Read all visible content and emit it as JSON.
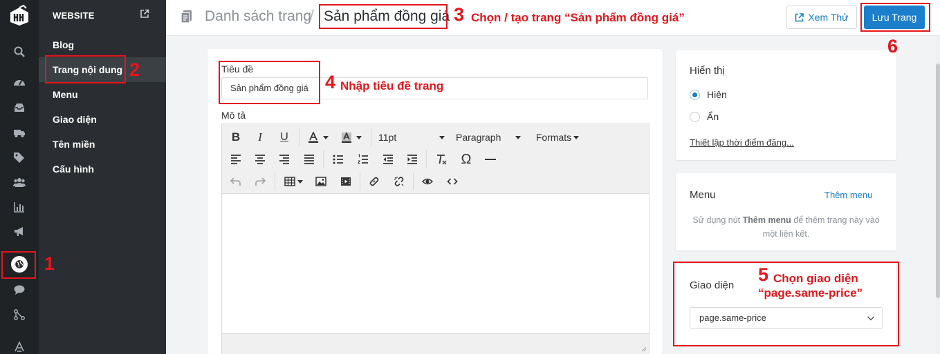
{
  "sidebar": {
    "section_title": "WEBSITE",
    "items": [
      {
        "label": "Blog"
      },
      {
        "label": "Trang nội dung"
      },
      {
        "label": "Menu"
      },
      {
        "label": "Giao diện"
      },
      {
        "label": "Tên miền"
      },
      {
        "label": "Cấu hình"
      }
    ]
  },
  "rail_icons": [
    "logo-icon",
    "search-icon",
    "dashboard-icon",
    "inbox-icon",
    "truck-icon",
    "tags-icon",
    "users-icon",
    "chart-icon",
    "megaphone-icon",
    "globe-icon",
    "chat-icon",
    "share-icon",
    "app-icon"
  ],
  "header": {
    "breadcrumb": "Danh sách trang",
    "separator": "/",
    "current": "Sản phẩm đồng giá",
    "view_button": "Xem Thử",
    "save_button": "Lưu Trang"
  },
  "form": {
    "title_label": "Tiêu đề",
    "title_value": "Sản phẩm đồng giá",
    "desc_label": "Mô tả"
  },
  "editor": {
    "font_size": "11pt",
    "block_format": "Paragraph",
    "formats": "Formats"
  },
  "visibility": {
    "title": "Hiển thị",
    "option_show": "Hiện",
    "option_hide": "Ẩn",
    "selected": "Hiện",
    "schedule_link": "Thiết lập thời điểm đăng..."
  },
  "menu_panel": {
    "title": "Menu",
    "add_link": "Thêm menu",
    "hint_prefix": "Sử dụng nút",
    "hint_bold": "Thêm menu",
    "hint_suffix": "để thêm trang này vào một liên kết."
  },
  "template_panel": {
    "title": "Giao diện",
    "selected": "page.same-price"
  },
  "annotations": {
    "n1": "1",
    "n2": "2",
    "n3": "3",
    "t3": "Chọn / tạo trang “Sản phẩm đồng giá”",
    "n4": "4",
    "t4": "Nhập tiêu đề trang",
    "n5": "5",
    "t5_line1": "Chọn giao diện",
    "t5_line2": "“page.same-price”",
    "n6": "6"
  },
  "colors": {
    "accent": "#1b7fcb",
    "annotation": "#e3161b",
    "rail_bg": "#1f2326",
    "sub_bg": "#2a2e32"
  }
}
